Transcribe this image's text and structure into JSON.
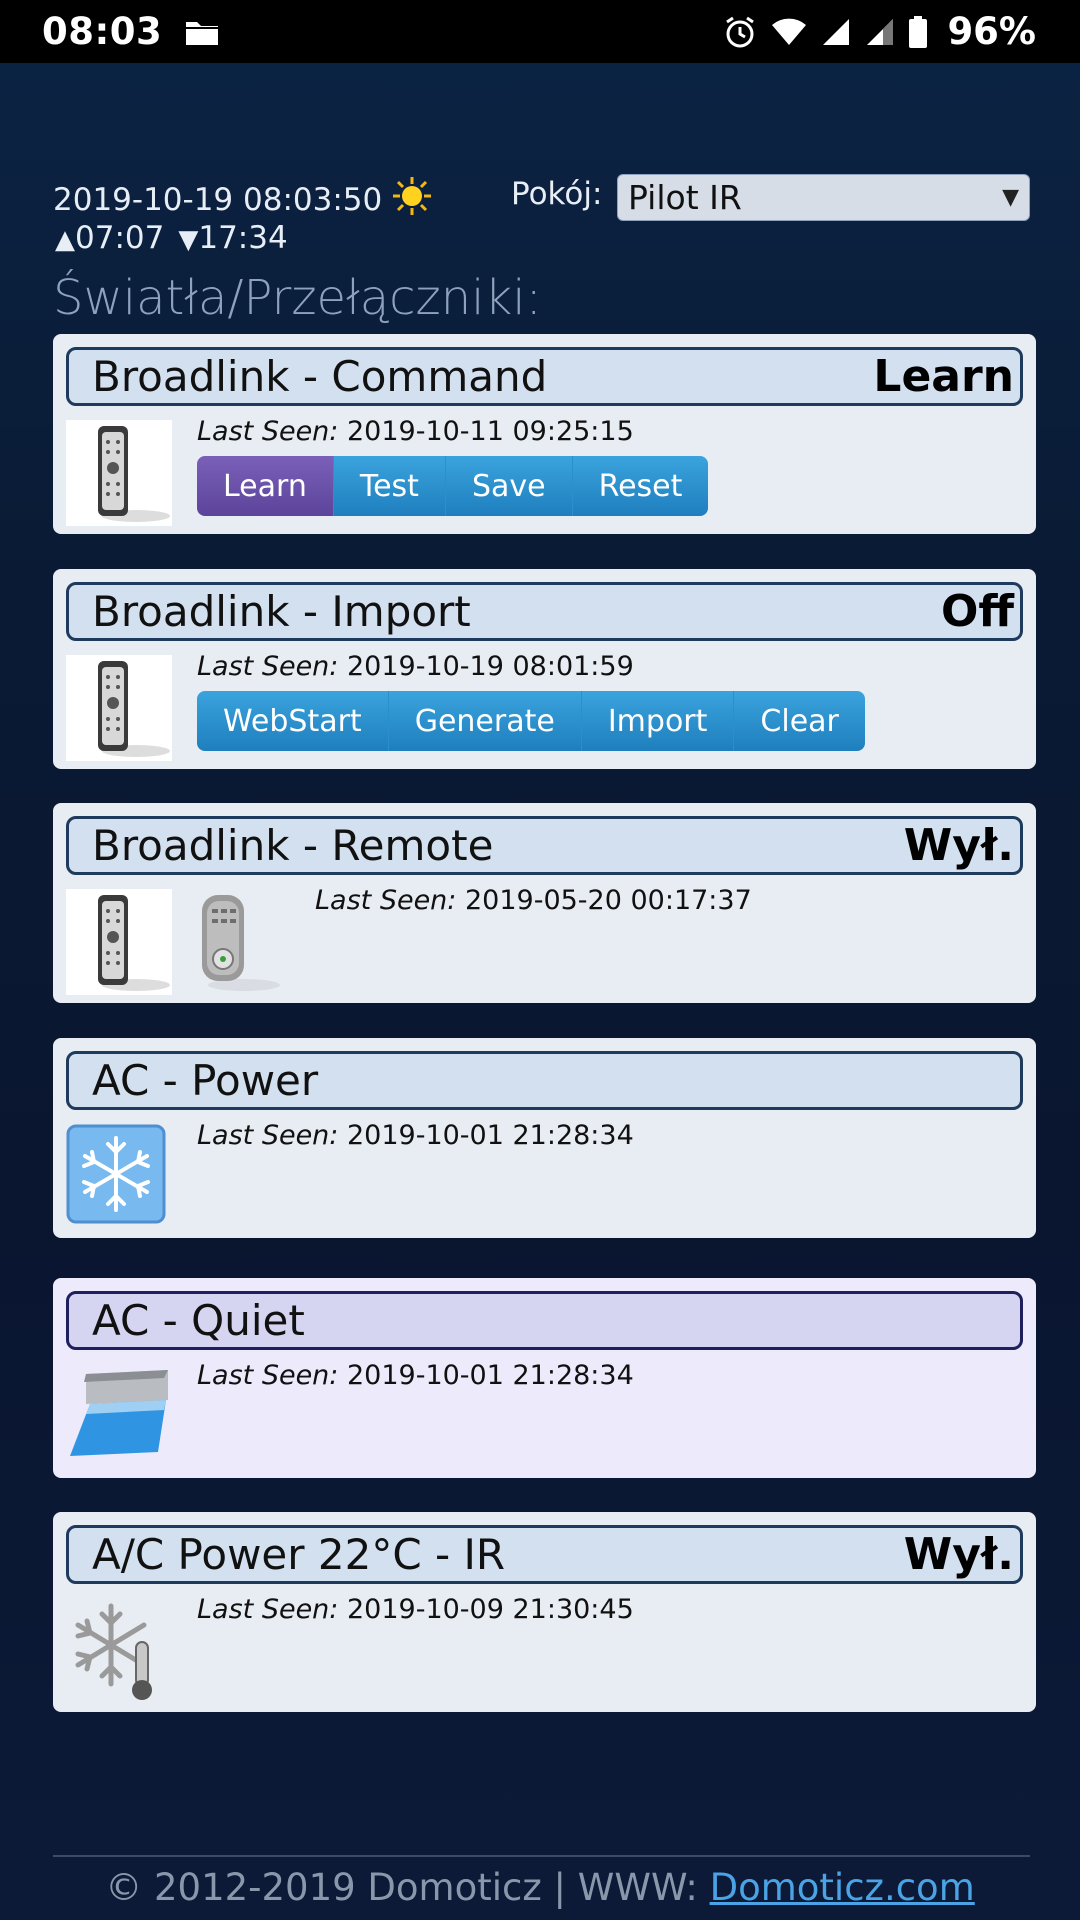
{
  "status_bar": {
    "time": "08:03",
    "battery": "96%",
    "icons": [
      "folder-icon",
      "alarm-icon",
      "wifi-icon",
      "signal-icon",
      "signal-icon",
      "battery-icon"
    ]
  },
  "header": {
    "datetime": "2019-10-19 08:03:50",
    "sunrise": "07:07",
    "sunset": "17:34",
    "room_label": "Pokój:",
    "room_value": "Pilot IR",
    "section_title": "Światła/Przełączniki:"
  },
  "devices": [
    {
      "name": "Broadlink - Command",
      "status": "Learn",
      "last_seen_label": "Last Seen:",
      "last_seen": "2019-10-11 09:25:15",
      "icon": "remote-icon",
      "buttons": [
        "Learn",
        "Test",
        "Save",
        "Reset"
      ],
      "active_button": "Learn"
    },
    {
      "name": "Broadlink - Import",
      "status": "Off",
      "last_seen_label": "Last Seen:",
      "last_seen": "2019-10-19 08:01:59",
      "icon": "remote-icon",
      "buttons": [
        "WebStart",
        "Generate",
        "Import",
        "Clear"
      ]
    },
    {
      "name": "Broadlink - Remote",
      "status": "Wył.",
      "last_seen_label": "Last Seen:",
      "last_seen": "2019-05-20 00:17:37",
      "icon": "remote-icon"
    },
    {
      "name": "AC - Power",
      "status": "",
      "last_seen_label": "Last Seen:",
      "last_seen": "2019-10-01 21:28:34",
      "icon": "snowflake-icon"
    },
    {
      "name": "AC - Quiet",
      "status": "",
      "last_seen_label": "Last Seen:",
      "last_seen": "2019-10-01 21:28:34",
      "icon": "air-conditioner-icon"
    },
    {
      "name": "A/C Power 22°C - IR",
      "status": "Wył.",
      "last_seen_label": "Last Seen:",
      "last_seen": "2019-10-09 21:30:45",
      "icon": "snowflake-thermometer-icon"
    }
  ],
  "footer": {
    "text": "© 2012-2019 Domoticz | WWW: ",
    "link": "Domoticz.com"
  },
  "colors": {
    "accent": "#2b8fcc",
    "active_button": "#6a52a8",
    "background": "#0b1d3a"
  }
}
